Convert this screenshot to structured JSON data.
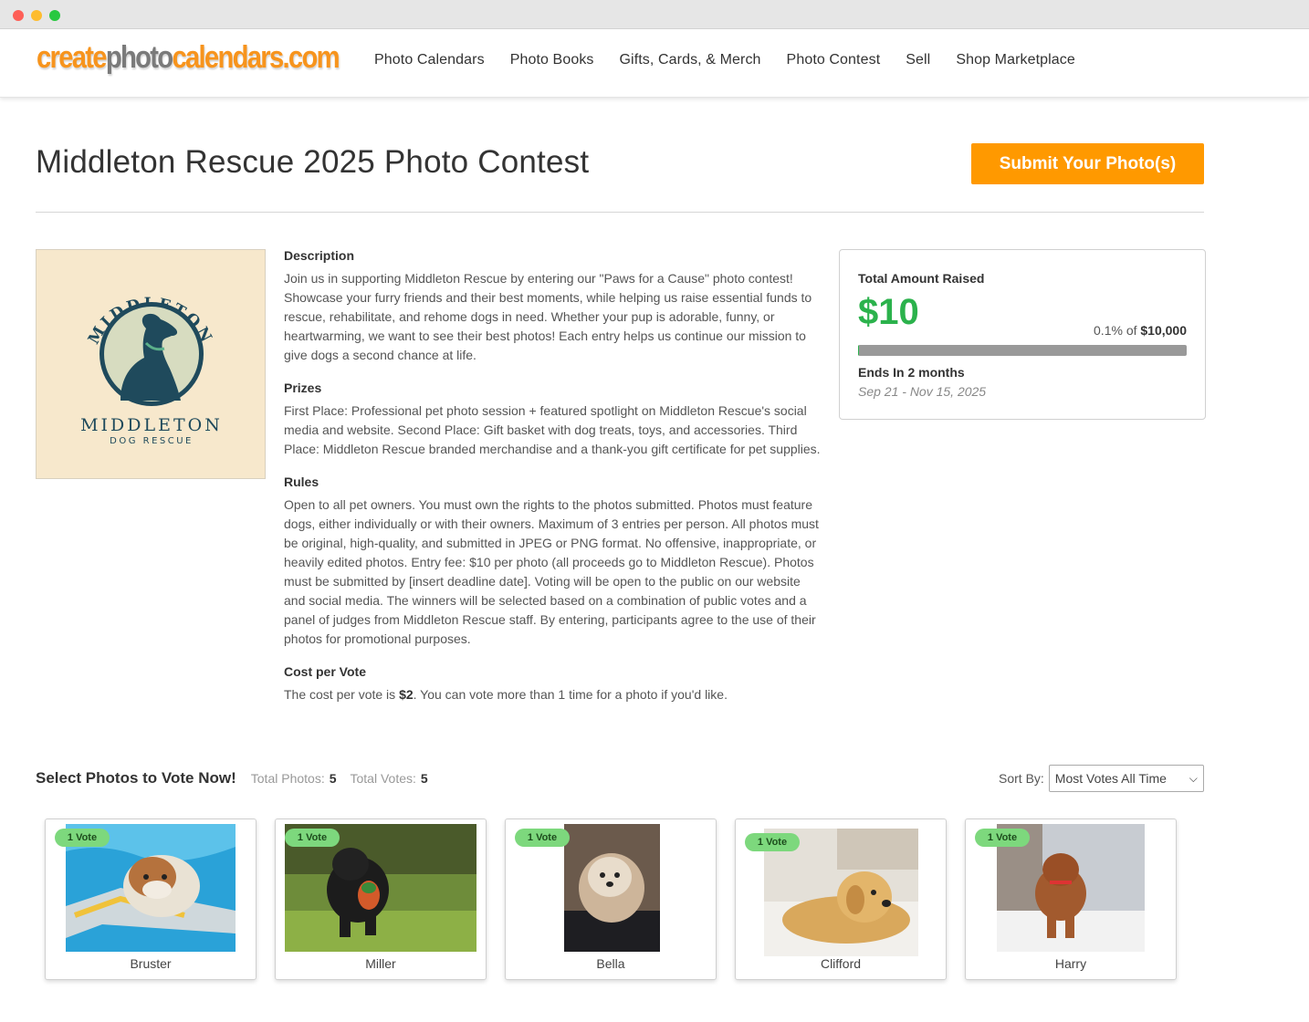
{
  "navbar": {
    "logo": {
      "part1": "create",
      "part2": "photo",
      "part3": "calendars",
      "part4": ".com"
    },
    "links": [
      "Photo Calendars",
      "Photo Books",
      "Gifts, Cards, & Merch",
      "Photo Contest",
      "Sell",
      "Shop Marketplace"
    ]
  },
  "contest": {
    "title": "Middleton Rescue 2025 Photo Contest",
    "submit_label": "Submit Your Photo(s)",
    "logo": {
      "arc_text": "MIDDLETON",
      "name": "MIDDLETON",
      "subtitle": "DOG RESCUE"
    },
    "description": {
      "heading": "Description",
      "text": "Join us in supporting Middleton Rescue by entering our \"Paws for a Cause\" photo contest! Showcase your furry friends and their best moments, while helping us raise essential funds to rescue, rehabilitate, and rehome dogs in need. Whether your pup is adorable, funny, or heartwarming, we want to see their best photos! Each entry helps us continue our mission to give dogs a second chance at life."
    },
    "prizes": {
      "heading": "Prizes",
      "text": "First Place: Professional pet photo session + featured spotlight on Middleton Rescue's social media and website. Second Place: Gift basket with dog treats, toys, and accessories. Third Place: Middleton Rescue branded merchandise and a thank-you gift certificate for pet supplies."
    },
    "rules": {
      "heading": "Rules",
      "text": "Open to all pet owners. You must own the rights to the photos submitted. Photos must feature dogs, either individually or with their owners. Maximum of 3 entries per person. All photos must be original, high-quality, and submitted in JPEG or PNG format. No offensive, inappropriate, or heavily edited photos. Entry fee: $10 per photo (all proceeds go to Middleton Rescue). Photos must be submitted by [insert deadline date]. Voting will be open to the public on our website and social media. The winners will be selected based on a combination of public votes and a panel of judges from Middleton Rescue staff. By entering, participants agree to the use of their photos for promotional purposes."
    },
    "cost": {
      "heading": "Cost per Vote",
      "prefix": "The cost per vote is ",
      "amount": "$2",
      "suffix": ". You can vote more than 1 time for a photo if you'd like."
    }
  },
  "fundraiser": {
    "label": "Total Amount Raised",
    "amount": "$10",
    "percent_text": "0.1% of",
    "goal": "$10,000",
    "progress_fraction": 0.001,
    "ends": "Ends In 2 months",
    "dates": "Sep 21 - Nov 15, 2025",
    "colors": {
      "amount": "#2bb24c",
      "track": "#999999"
    }
  },
  "voting": {
    "title": "Select Photos to Vote Now!",
    "total_photos_label": "Total Photos:",
    "total_photos": "5",
    "total_votes_label": "Total Votes:",
    "total_votes": "5",
    "sort_label": "Sort By:",
    "sort_value": "Most Votes All Time",
    "entries": [
      {
        "name": "Bruster",
        "votes": "1 Vote"
      },
      {
        "name": "Miller",
        "votes": "1 Vote"
      },
      {
        "name": "Bella",
        "votes": "1 Vote"
      },
      {
        "name": "Clifford",
        "votes": "1 Vote"
      },
      {
        "name": "Harry",
        "votes": "1 Vote"
      }
    ]
  },
  "colors": {
    "accent": "#ff9900",
    "logo_orange": "#f7941d",
    "logo_gray": "#7a7a7a",
    "vote_badge": "#7dd87d"
  }
}
